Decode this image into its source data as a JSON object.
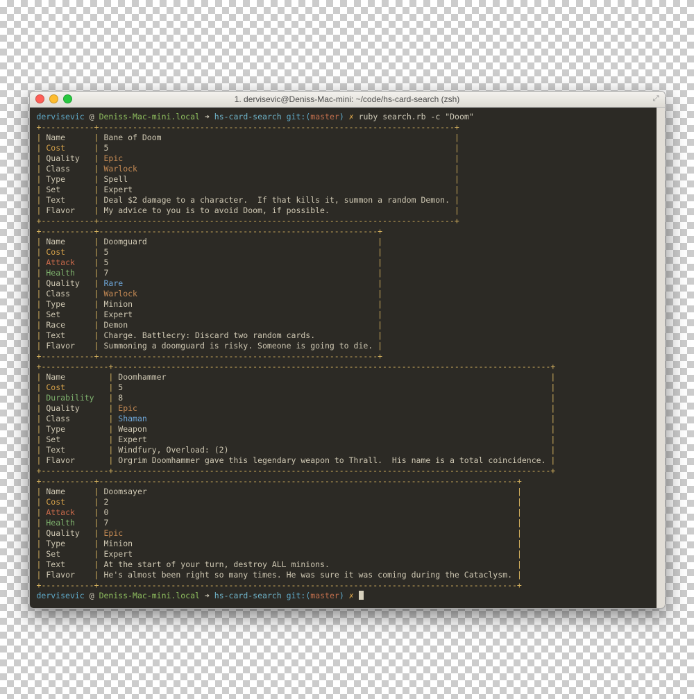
{
  "window": {
    "title": "1. dervisevic@Deniss-Mac-mini: ~/code/hs-card-search (zsh)"
  },
  "prompt": {
    "user": "dervisevic",
    "at": "@",
    "host": "Deniss-Mac-mini.local",
    "arrow": "➜",
    "path": "hs-card-search",
    "git_prefix": "git:(",
    "branch": "master",
    "git_suffix": ")",
    "dirty": "✗",
    "command": "ruby search.rb -c \"Doom\""
  },
  "cards": [
    {
      "kcol": 9,
      "rows": [
        {
          "k": "Name",
          "kc": "c-label",
          "v": "Bane of Doom",
          "vc": "c-text"
        },
        {
          "k": "Cost",
          "kc": "c-cost",
          "v": "5",
          "vc": "c-text"
        },
        {
          "k": "Quality",
          "kc": "c-label",
          "v": "Epic",
          "vc": "c-epic"
        },
        {
          "k": "Class",
          "kc": "c-label",
          "v": "Warlock",
          "vc": "c-class"
        },
        {
          "k": "Type",
          "kc": "c-label",
          "v": "Spell",
          "vc": "c-text"
        },
        {
          "k": "Set",
          "kc": "c-label",
          "v": "Expert",
          "vc": "c-text"
        },
        {
          "k": "Text",
          "kc": "c-label",
          "v": "Deal $2 damage to a character.  If that kills it, summon a random Demon.",
          "vc": "c-text"
        },
        {
          "k": "Flavor",
          "kc": "c-label",
          "v": "My advice to you is to avoid Doom, if possible.",
          "vc": "c-text"
        }
      ]
    },
    {
      "kcol": 9,
      "rows": [
        {
          "k": "Name",
          "kc": "c-label",
          "v": "Doomguard",
          "vc": "c-text"
        },
        {
          "k": "Cost",
          "kc": "c-cost",
          "v": "5",
          "vc": "c-text"
        },
        {
          "k": "Attack",
          "kc": "c-attack",
          "v": "5",
          "vc": "c-text"
        },
        {
          "k": "Health",
          "kc": "c-health",
          "v": "7",
          "vc": "c-text"
        },
        {
          "k": "Quality",
          "kc": "c-label",
          "v": "Rare",
          "vc": "c-rare"
        },
        {
          "k": "Class",
          "kc": "c-label",
          "v": "Warlock",
          "vc": "c-class"
        },
        {
          "k": "Type",
          "kc": "c-label",
          "v": "Minion",
          "vc": "c-text"
        },
        {
          "k": "Set",
          "kc": "c-label",
          "v": "Expert",
          "vc": "c-text"
        },
        {
          "k": "Race",
          "kc": "c-label",
          "v": "Demon",
          "vc": "c-text"
        },
        {
          "k": "Text",
          "kc": "c-label",
          "v": "Charge. Battlecry: Discard two random cards.",
          "vc": "c-text"
        },
        {
          "k": "Flavor",
          "kc": "c-label",
          "v": "Summoning a doomguard is risky. Someone is going to die.",
          "vc": "c-text"
        }
      ]
    },
    {
      "kcol": 12,
      "rows": [
        {
          "k": "Name",
          "kc": "c-label",
          "v": "Doomhammer",
          "vc": "c-text"
        },
        {
          "k": "Cost",
          "kc": "c-cost",
          "v": "5",
          "vc": "c-text"
        },
        {
          "k": "Durability",
          "kc": "c-dur",
          "v": "8",
          "vc": "c-text"
        },
        {
          "k": "Quality",
          "kc": "c-label",
          "v": "Epic",
          "vc": "c-epic"
        },
        {
          "k": "Class",
          "kc": "c-label",
          "v": "Shaman",
          "vc": "c-classblue"
        },
        {
          "k": "Type",
          "kc": "c-label",
          "v": "Weapon",
          "vc": "c-text"
        },
        {
          "k": "Set",
          "kc": "c-label",
          "v": "Expert",
          "vc": "c-text"
        },
        {
          "k": "Text",
          "kc": "c-label",
          "v": "Windfury, Overload: (2)",
          "vc": "c-text"
        },
        {
          "k": "Flavor",
          "kc": "c-label",
          "v": "Orgrim Doomhammer gave this legendary weapon to Thrall.  His name is a total coincidence.",
          "vc": "c-text"
        }
      ]
    },
    {
      "kcol": 9,
      "rows": [
        {
          "k": "Name",
          "kc": "c-label",
          "v": "Doomsayer",
          "vc": "c-text"
        },
        {
          "k": "Cost",
          "kc": "c-cost",
          "v": "2",
          "vc": "c-text"
        },
        {
          "k": "Attack",
          "kc": "c-attack",
          "v": "0",
          "vc": "c-text"
        },
        {
          "k": "Health",
          "kc": "c-health",
          "v": "7",
          "vc": "c-text"
        },
        {
          "k": "Quality",
          "kc": "c-label",
          "v": "Epic",
          "vc": "c-epic"
        },
        {
          "k": "Type",
          "kc": "c-label",
          "v": "Minion",
          "vc": "c-text"
        },
        {
          "k": "Set",
          "kc": "c-label",
          "v": "Expert",
          "vc": "c-text"
        },
        {
          "k": "Text",
          "kc": "c-label",
          "v": "At the start of your turn, destroy ALL minions.",
          "vc": "c-text"
        },
        {
          "k": "Flavor",
          "kc": "c-label",
          "v": "He's almost been right so many times. He was sure it was coming during the Cataclysm.",
          "vc": "c-text"
        }
      ]
    }
  ]
}
